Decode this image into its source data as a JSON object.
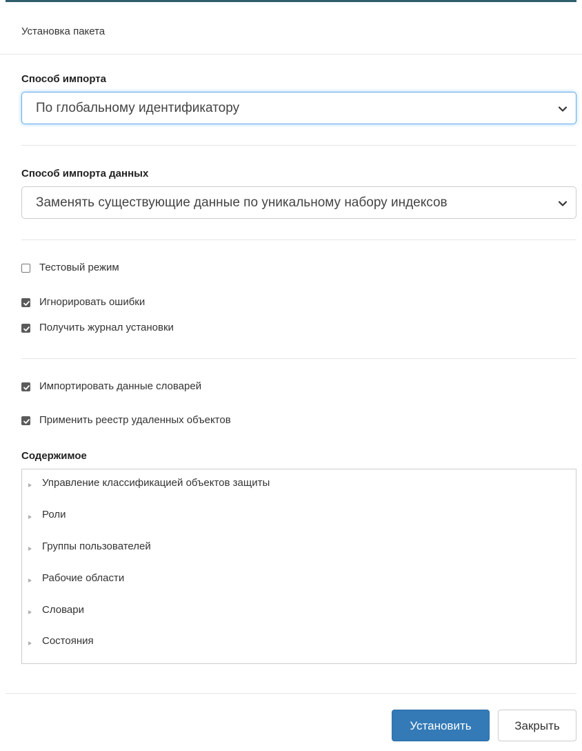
{
  "dialog": {
    "title": "Установка пакета"
  },
  "import_method": {
    "label": "Способ импорта",
    "selected": "По глобальному идентификатору"
  },
  "data_import_method": {
    "label": "Способ импорта данных",
    "selected": "Заменять существующие данные по уникальному набору индексов"
  },
  "options": {
    "test_mode": {
      "label": "Тестовый режим",
      "checked": false
    },
    "ignore_errors": {
      "label": "Игнорировать ошибки",
      "checked": true
    },
    "get_install_log": {
      "label": "Получить журнал установки",
      "checked": true
    },
    "import_dictionary_data": {
      "label": "Импортировать данные словарей",
      "checked": true
    },
    "apply_deleted_registry": {
      "label": "Применить реестр удаленных объектов",
      "checked": true
    }
  },
  "contents": {
    "label": "Содержимое",
    "items": [
      {
        "label": "Управление классификацией объектов защиты"
      },
      {
        "label": "Роли"
      },
      {
        "label": "Группы пользователей"
      },
      {
        "label": "Рабочие области"
      },
      {
        "label": "Словари"
      },
      {
        "label": "Состояния"
      }
    ]
  },
  "footer": {
    "install_label": "Установить",
    "close_label": "Закрыть"
  },
  "colors": {
    "primary": "#337ab7",
    "accent_top": "#2e5d6b",
    "focus_border": "#66afe9"
  }
}
